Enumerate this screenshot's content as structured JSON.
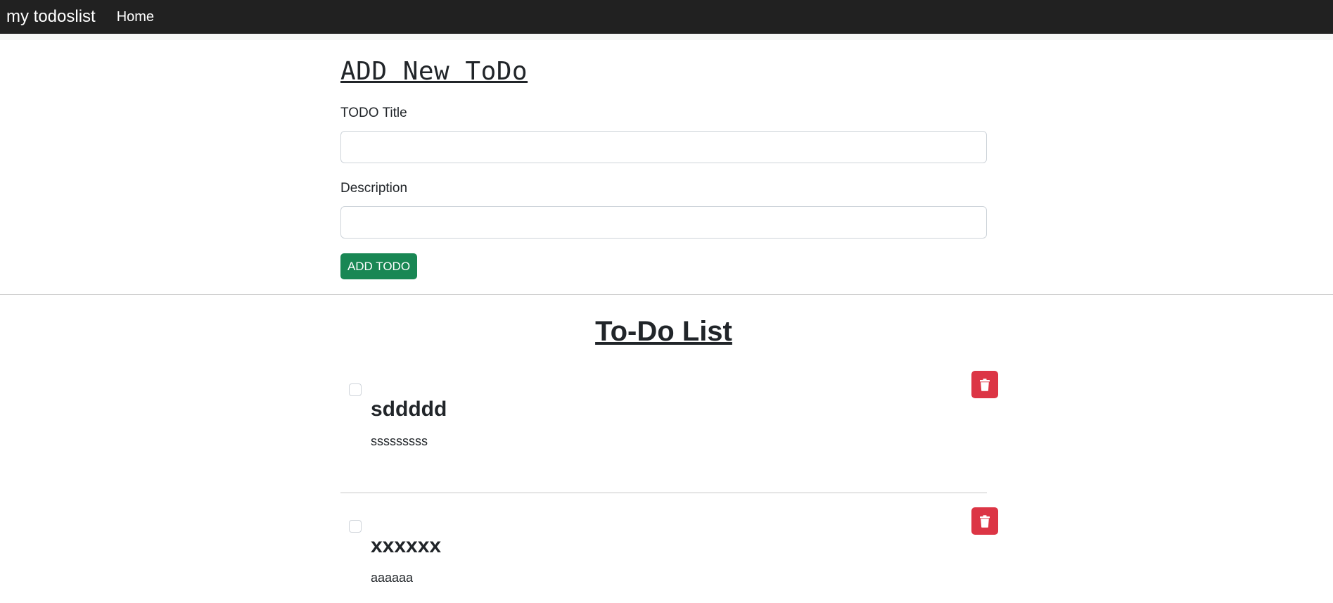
{
  "navbar": {
    "brand": "my todoslist",
    "links": [
      {
        "label": "Home"
      }
    ]
  },
  "form": {
    "heading": "ADD New ToDo",
    "title_label": "TODO Title",
    "title_value": "",
    "description_label": "Description",
    "description_value": "",
    "submit_label": "ADD TODO"
  },
  "list": {
    "heading": "To-Do List",
    "items": [
      {
        "title": "sddddd",
        "description": "sssssssss",
        "checked": false,
        "delete_icon": "trash-icon"
      },
      {
        "title": "xxxxxx",
        "description": "aaaaaa",
        "checked": false,
        "delete_icon": "trash-icon"
      }
    ]
  },
  "colors": {
    "navbar_bg": "#212121",
    "add_button": "#198754",
    "delete_button": "#dc3545"
  }
}
